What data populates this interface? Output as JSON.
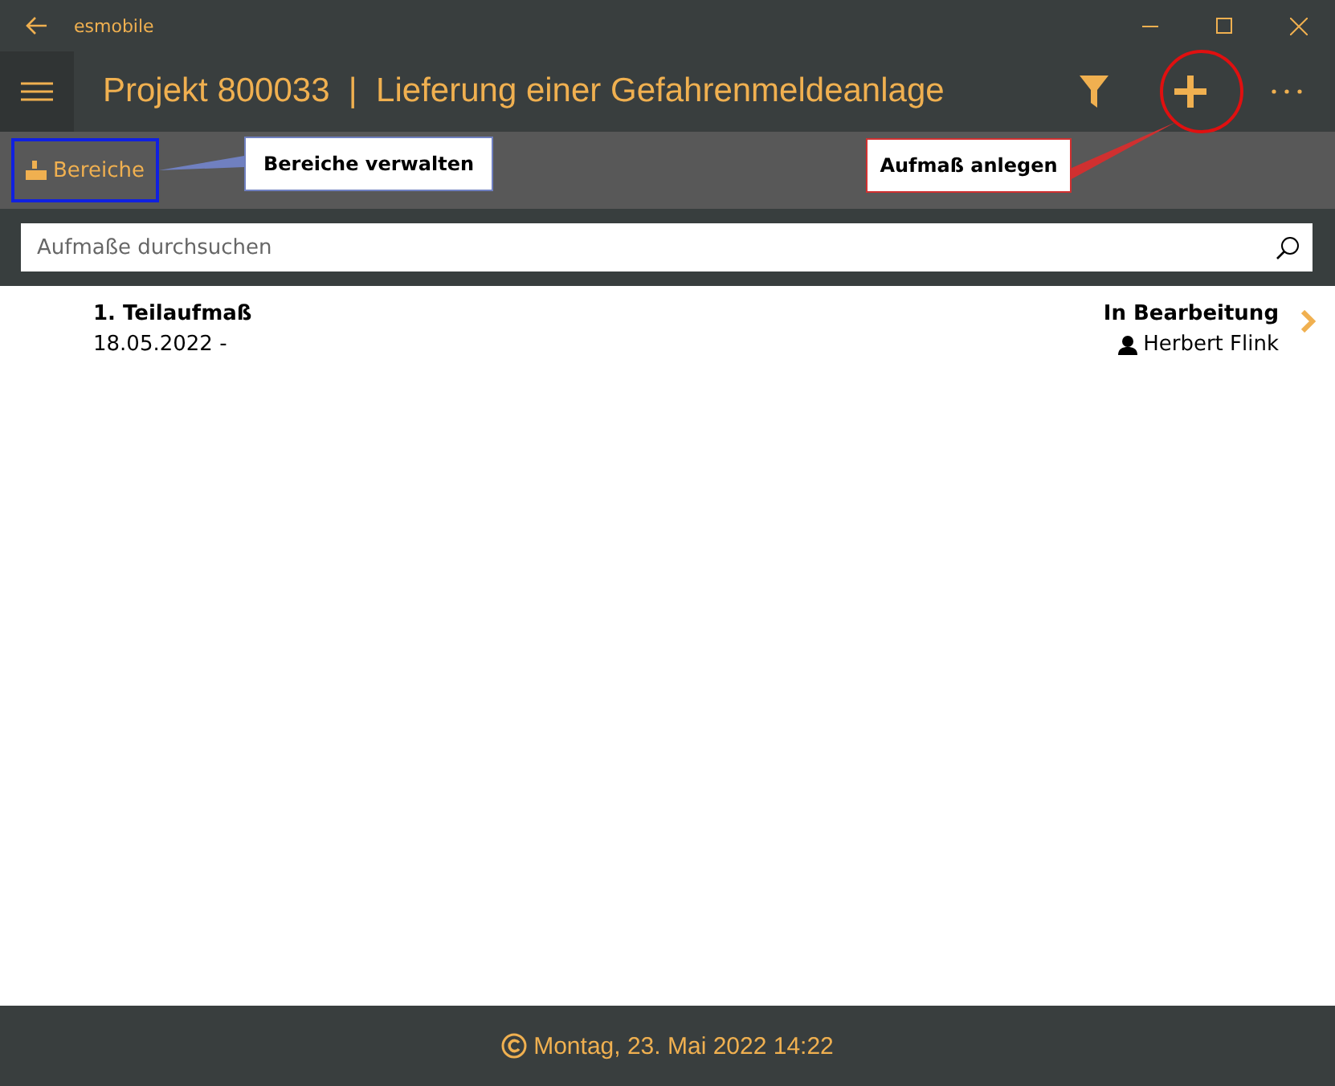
{
  "window": {
    "title": "esmobile"
  },
  "header": {
    "title": "Projekt 800033  |  Lieferung einer Gefahrenmeldeanlage"
  },
  "toolbar": {
    "button": "Bereiche"
  },
  "search": {
    "placeholder": "Aufmaße durchsuchen"
  },
  "items": [
    {
      "title": "1. Teilaufmaß",
      "date": "18.05.2022 -",
      "status": "In Bearbeitung",
      "user": "Herbert Flink"
    }
  ],
  "status_bar": {
    "text": "Montag, 23. Mai 2022 14:22"
  },
  "annotations": [
    {
      "kind": "blue",
      "text": "Bereiche verwalten"
    },
    {
      "kind": "red",
      "text": "Aufmaß anlegen"
    }
  ]
}
